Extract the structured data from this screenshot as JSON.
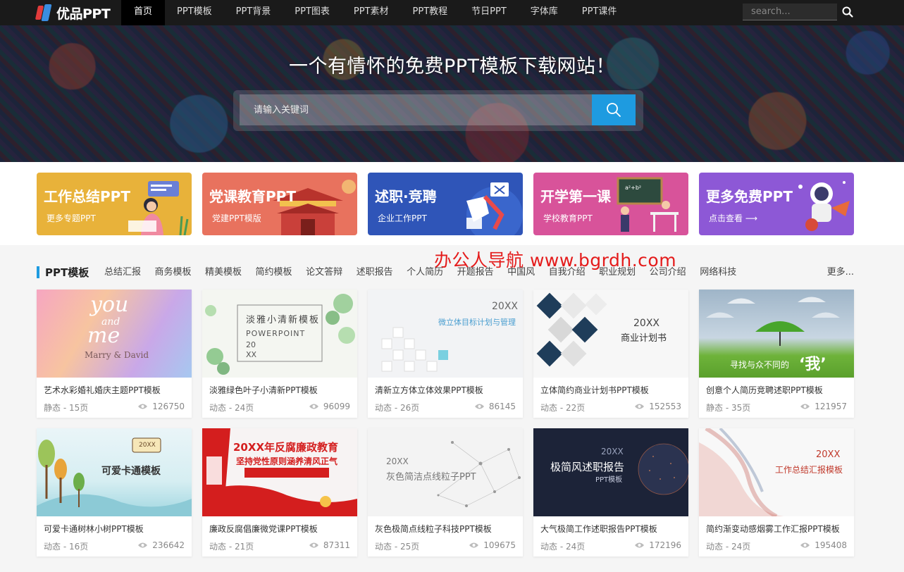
{
  "topbar": {
    "logo": "优品PPT",
    "nav": [
      "首页",
      "PPT模板",
      "PPT背景",
      "PPT图表",
      "PPT素材",
      "PPT教程",
      "节日PPT",
      "字体库",
      "PPT课件"
    ],
    "search_placeholder": "search...",
    "search_icon": "search-icon"
  },
  "hero": {
    "title": "一个有情怀的免费PPT模板下载网站！",
    "search_placeholder": "请输入关键词",
    "search_icon": "search-icon"
  },
  "banners": [
    {
      "title": "工作总结PPT",
      "sub": "更多专题PPT",
      "color": "#e8b23a"
    },
    {
      "title": "党课教育PPT",
      "sub": "党建PPT模版",
      "color": "#e8725e"
    },
    {
      "title": "述职·竞聘",
      "sub": "企业工作PPT",
      "color": "#2f55b8"
    },
    {
      "title": "开学第一课",
      "sub": "学校教育PPT",
      "color": "#d8539a"
    },
    {
      "title": "更多免费PPT",
      "sub": "点击查看 ⟶",
      "color": "#8d58d6"
    }
  ],
  "watermark": "办公人导航  www.bgrdh.com",
  "section": {
    "title": "PPT模板",
    "tags": [
      "总结汇报",
      "商务模板",
      "精美模板",
      "简约模板",
      "论文答辩",
      "述职报告",
      "个人简历",
      "开题报告",
      "中国风",
      "自我介绍",
      "职业规划",
      "公司介绍",
      "网络科技"
    ],
    "more": "更多..."
  },
  "cards": [
    {
      "title": "艺术水彩婚礼婚庆主题PPT模板",
      "meta": "静态 - 15页",
      "views": "126750",
      "thumb_text": [
        "you",
        "and",
        "me",
        "Marry & David"
      ]
    },
    {
      "title": "淡雅绿色叶子小清新PPT模板",
      "meta": "动态 - 24页",
      "views": "96099",
      "thumb_text": [
        "淡雅小清新模板",
        "POWERPOINT",
        "20",
        "XX"
      ]
    },
    {
      "title": "清新立方体立体效果PPT模板",
      "meta": "动态 - 26页",
      "views": "86145",
      "thumb_text": [
        "20XX",
        "微立体目标计划与管理"
      ]
    },
    {
      "title": "立体简约商业计划书PPT模板",
      "meta": "动态 - 22页",
      "views": "152553",
      "thumb_text": [
        "20XX",
        "商业计划书"
      ]
    },
    {
      "title": "创意个人简历竞聘述职PPT模板",
      "meta": "静态 - 35页",
      "views": "121957",
      "thumb_text": [
        "寻找与众不同的",
        "‘我’"
      ]
    },
    {
      "title": "可爱卡通树林小树PPT模板",
      "meta": "动态 - 16页",
      "views": "236642",
      "thumb_text": [
        "可爱卡通模板",
        "20XX"
      ]
    },
    {
      "title": "廉政反腐倡廉微党课PPT模板",
      "meta": "动态 - 21页",
      "views": "87311",
      "thumb_text": [
        "20XX年反腐廉政教育",
        "坚持党性原则涵养清风正气"
      ]
    },
    {
      "title": "灰色极简点线粒子科技PPT模板",
      "meta": "动态 - 25页",
      "views": "109675",
      "thumb_text": [
        "20XX",
        "灰色简洁点线粒子PPT"
      ]
    },
    {
      "title": "大气极简工作述职报告PPT模板",
      "meta": "动态 - 24页",
      "views": "172196",
      "thumb_text": [
        "20XX",
        "极简风述职报告",
        "PPT模板"
      ]
    },
    {
      "title": "简约渐变动感烟雾工作汇报PPT模板",
      "meta": "动态 - 24页",
      "views": "195408",
      "thumb_text": [
        "20XX",
        "工作总结汇报模板"
      ]
    }
  ]
}
